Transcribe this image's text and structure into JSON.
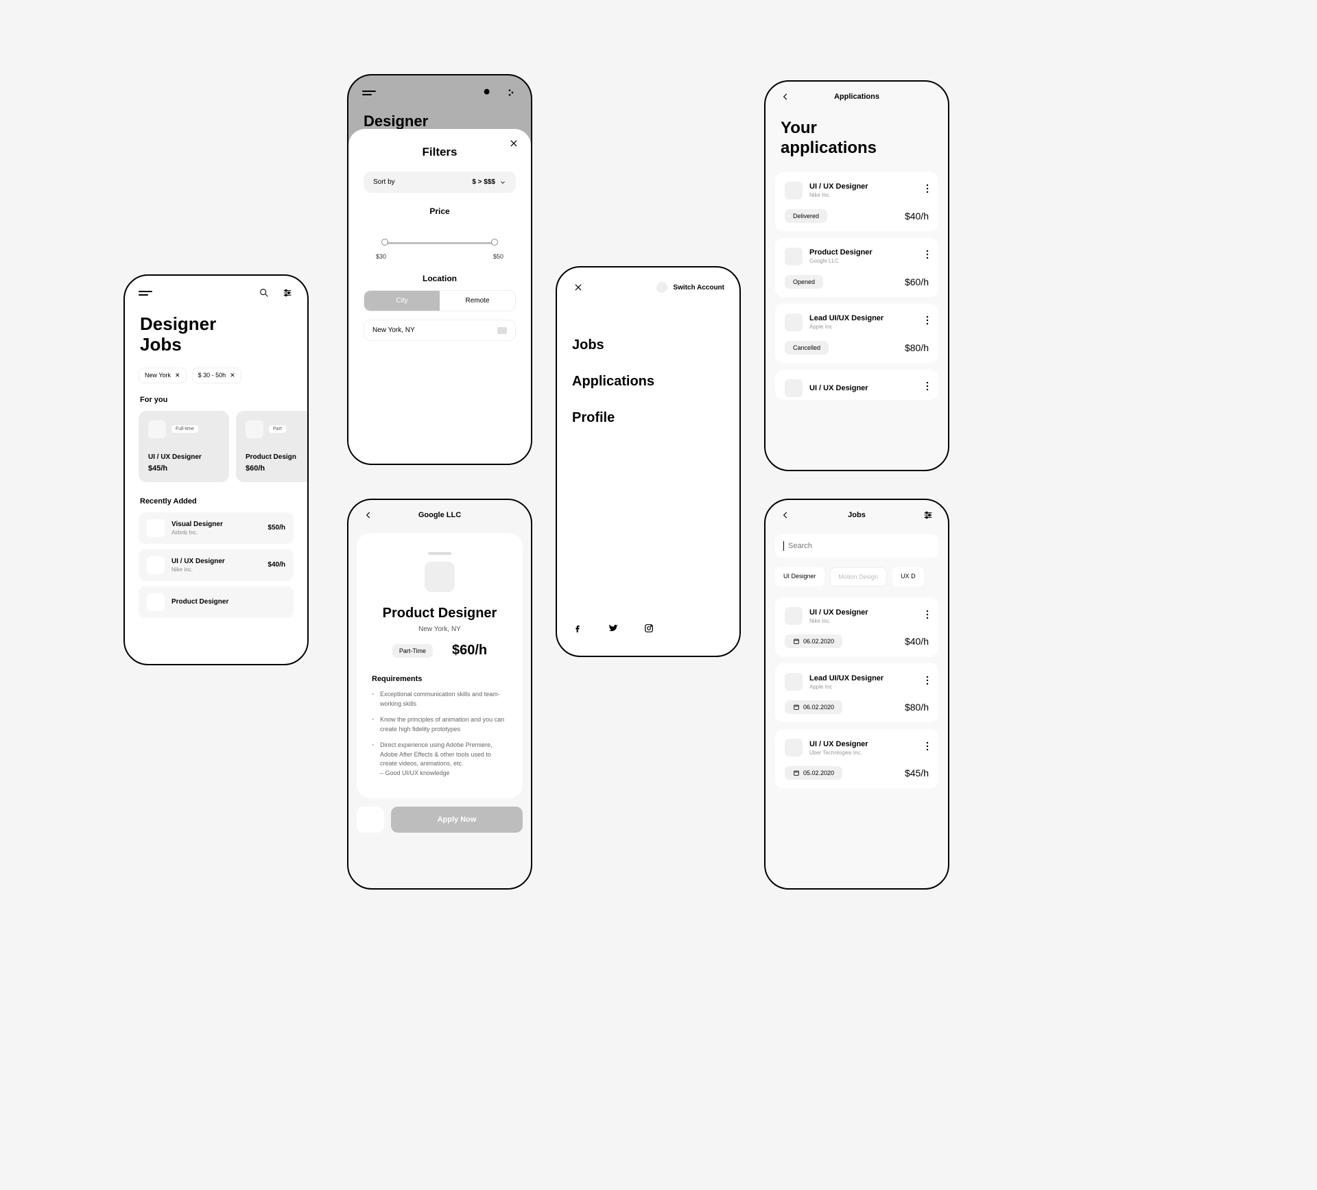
{
  "screen1": {
    "title": "Designer\nJobs",
    "chips": [
      {
        "label": "New York"
      },
      {
        "label": "$ 30 - 50h"
      }
    ],
    "forYouHeading": "For you",
    "forYou": [
      {
        "title": "UI / UX Designer",
        "rate": "$45/h",
        "badge": "Full-time"
      },
      {
        "title": "Product Design",
        "rate": "$60/h",
        "badge": "Part"
      }
    ],
    "recentHeading": "Recently Added",
    "recent": [
      {
        "title": "Visual Designer",
        "sub": "Airbnb Inc.",
        "rate": "$50/h"
      },
      {
        "title": "UI / UX Designer",
        "sub": "Nike Inc.",
        "rate": "$40/h"
      },
      {
        "title": "Product Designer",
        "sub": "",
        "rate": ""
      }
    ]
  },
  "screen2": {
    "titleBg": "Designer",
    "sheetTitle": "Filters",
    "sortLabel": "Sort by",
    "sortValue": "$  >  $$$",
    "priceHeading": "Price",
    "priceMin": "$30",
    "priceMax": "$50",
    "locHeading": "Location",
    "segCity": "City",
    "segRemote": "Remote",
    "locValue": "New York, NY"
  },
  "screen3": {
    "header": "Google LLC",
    "jobTitle": "Product Designer",
    "jobLoc": "New York, NY",
    "jobType": "Part-Time",
    "jobRate": "$60/h",
    "reqHeading": "Requirements",
    "reqs": [
      "Exceptional communication skills and team-working skills",
      "Know the principles of animation and you can create high fidelity prototypes",
      "Direct experience using Adobe Premiere, Adobe After Effects & other tools used to create videos, animations, etc.\n– Good UI/UX knowledge"
    ],
    "applyLabel": "Apply Now"
  },
  "screen4": {
    "switchLabel": "Switch Account",
    "links": [
      "Jobs",
      "Applications",
      "Profile"
    ]
  },
  "screen5": {
    "header": "Applications",
    "title": "Your\napplications",
    "items": [
      {
        "title": "UI / UX Designer",
        "sub": "Nike Inc.",
        "status": "Delivered",
        "rate": "$40/h"
      },
      {
        "title": "Product Designer",
        "sub": "Google LLC",
        "status": "Opened",
        "rate": "$60/h"
      },
      {
        "title": "Lead UI/UX Designer",
        "sub": "Apple Inc",
        "status": "Cancelled",
        "rate": "$80/h"
      },
      {
        "title": "UI / UX Designer",
        "sub": "",
        "status": "",
        "rate": ""
      }
    ]
  },
  "screen6": {
    "header": "Jobs",
    "searchPlaceholder": "Search",
    "tags": [
      "UI  Designer",
      "Motion Design",
      "UX D"
    ],
    "items": [
      {
        "title": "UI / UX Designer",
        "sub": "Nike Inc.",
        "date": "06.02.2020",
        "rate": "$40/h"
      },
      {
        "title": "Lead UI/UX Designer",
        "sub": "Apple Inc",
        "date": "06.02.2020",
        "rate": "$80/h"
      },
      {
        "title": "UI / UX Designer",
        "sub": "Uber Technlogies Inc.",
        "date": "05.02.2020",
        "rate": "$45/h"
      }
    ]
  }
}
